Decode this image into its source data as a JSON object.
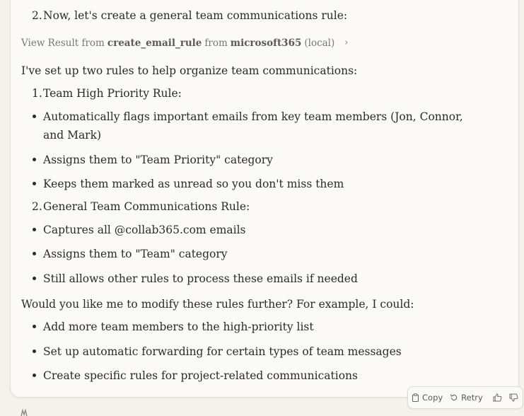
{
  "message": {
    "step2_number": "2.",
    "step2_text": "Now, let's create a general team communications rule:",
    "tool_result": {
      "prefix": "View Result from",
      "tool_name": "create_email_rule",
      "from_word": "from",
      "server": "microsoft365",
      "scope": "(local)"
    },
    "intro": "I've set up two rules to help organize team communications:",
    "rule1": {
      "number": "1.",
      "title": "Team High Priority Rule:",
      "bullets": [
        "Automatically flags important emails from key team members (Jon, Connor, and Mark)",
        "Assigns them to \"Team Priority\" category",
        "Keeps them marked as unread so you don't miss them"
      ]
    },
    "rule2": {
      "number": "2.",
      "title": "General Team Communications Rule:",
      "bullets": [
        "Captures all @collab365.com emails",
        "Assigns them to \"Team\" category",
        "Still allows other rules to process these emails if needed"
      ]
    },
    "followup": "Would you like me to modify these rules further? For example, I could:",
    "options": [
      "Add more team members to the high-priority list",
      "Set up automatic forwarding for certain types of team messages",
      "Create specific rules for project-related communications"
    ]
  },
  "actions": {
    "copy_label": "Copy",
    "retry_label": "Retry"
  },
  "icons": {
    "copy": "clipboard-icon",
    "retry": "retry-icon",
    "thumbs_up": "thumbs-up-icon",
    "thumbs_down": "thumbs-down-icon",
    "chevron": "chevron-right-icon"
  }
}
